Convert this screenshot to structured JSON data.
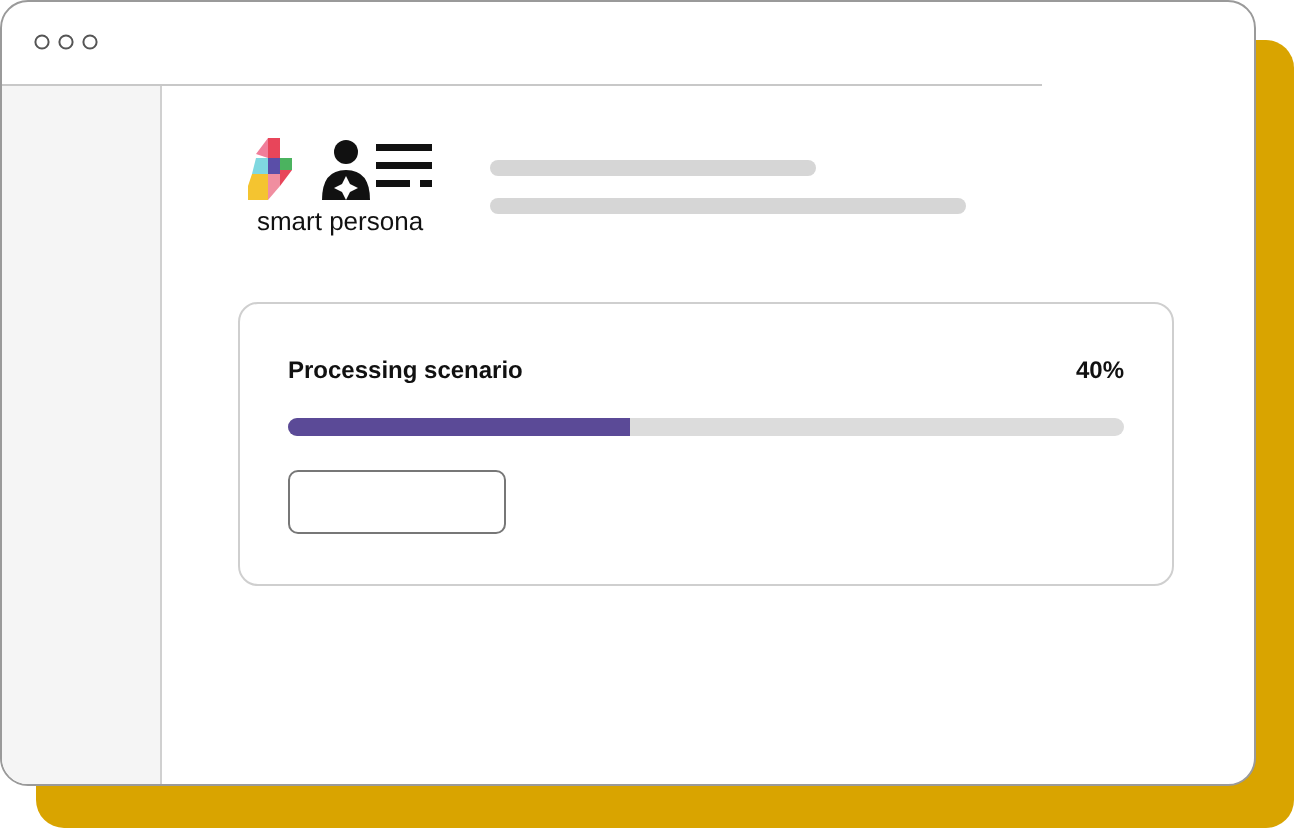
{
  "brand": {
    "name": "smart persona"
  },
  "progress": {
    "label": "Processing scenario",
    "reading": "40%",
    "level": 0.41
  }
}
